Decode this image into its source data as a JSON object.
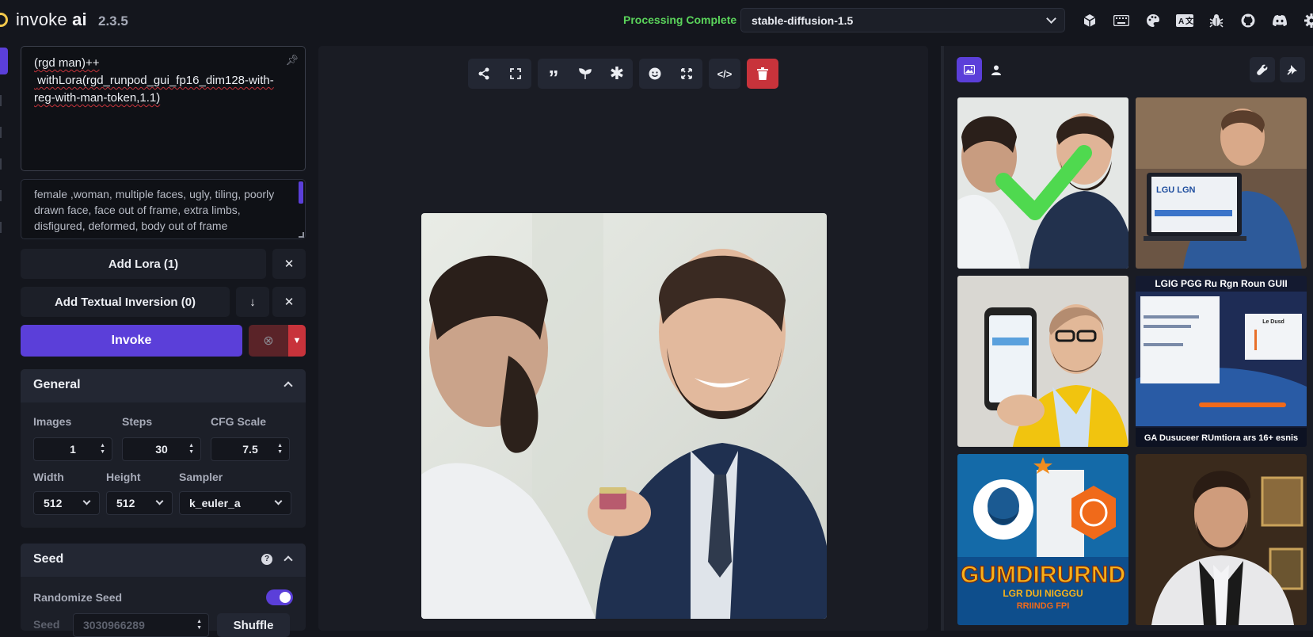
{
  "app": {
    "name_prefix": "invoke",
    "name_suffix": "ai",
    "version": "2.3.5",
    "status": "Processing Complete",
    "model": "stable-diffusion-1.5"
  },
  "header_icons": [
    "cube-icon",
    "keyboard-icon",
    "palette-icon",
    "language-icon",
    "bug-icon",
    "github-icon",
    "discord-icon",
    "settings-icon"
  ],
  "prompt": {
    "positive": "(rgd man)++\n withLora(rgd_runpod_gui_fp16_dim128-with-reg-with-man-token,1.1)",
    "negative": "female ,woman, multiple faces, ugly, tiling, poorly drawn face, face out of frame, extra limbs, disfigured, deformed, body out of frame"
  },
  "buttons": {
    "add_lora": "Add Lora (1)",
    "add_textual_inversion": "Add Textual Inversion (0)",
    "invoke": "Invoke"
  },
  "general": {
    "title": "General",
    "images_label": "Images",
    "images_value": "1",
    "steps_label": "Steps",
    "steps_value": "30",
    "cfg_label": "CFG Scale",
    "cfg_value": "7.5",
    "width_label": "Width",
    "width_value": "512",
    "height_label": "Height",
    "height_value": "512",
    "sampler_label": "Sampler",
    "sampler_value": "k_euler_a"
  },
  "seed": {
    "title": "Seed",
    "randomize_label": "Randomize Seed",
    "randomize_on": true,
    "seed_label": "Seed",
    "seed_value": "3030966289",
    "shuffle_label": "Shuffle"
  },
  "gallery_texts": {
    "thumb2_laptop": "LGU   LGN",
    "thumb4_title": "LGIG PGG Ru Rgn Roun GUII",
    "thumb4_caption": "GA Dusuceer RUmtiora ars 16+ esnis",
    "thumb4_panel": "Le Dusd",
    "thumb5_big": "GUMDIRURND",
    "thumb5_line2": "LGR DUI NIGGGU",
    "thumb5_line3": "RRIINDG FPI"
  },
  "colors": {
    "accent": "#5b3fd9",
    "status_green": "#5bd45b",
    "danger": "#c8333b",
    "background": "#14161d"
  }
}
